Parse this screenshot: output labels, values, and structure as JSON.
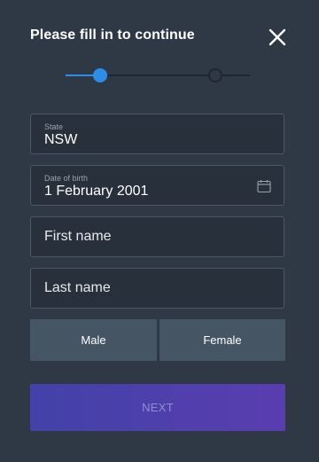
{
  "header": {
    "title": "Please fill in to continue"
  },
  "icons": {
    "close": "close-icon",
    "calendar": "calendar-icon"
  },
  "stepper": {
    "current_step": 1,
    "total_steps": 2
  },
  "form": {
    "state": {
      "label": "State",
      "value": "NSW"
    },
    "dob": {
      "label": "Date of birth",
      "value": "1 February 2001"
    },
    "first_name": {
      "placeholder": "First name",
      "value": ""
    },
    "last_name": {
      "placeholder": "Last name",
      "value": ""
    },
    "gender": {
      "male_label": "Male",
      "female_label": "Female"
    }
  },
  "actions": {
    "next_label": "NEXT"
  },
  "colors": {
    "background": "#2f3845",
    "field_background": "#28303b",
    "field_border": "#4c5765",
    "accent": "#2b8ee8",
    "gender_button": "#465564",
    "next_gradient_start": "#4242a8",
    "next_gradient_end": "#5a3db0"
  }
}
